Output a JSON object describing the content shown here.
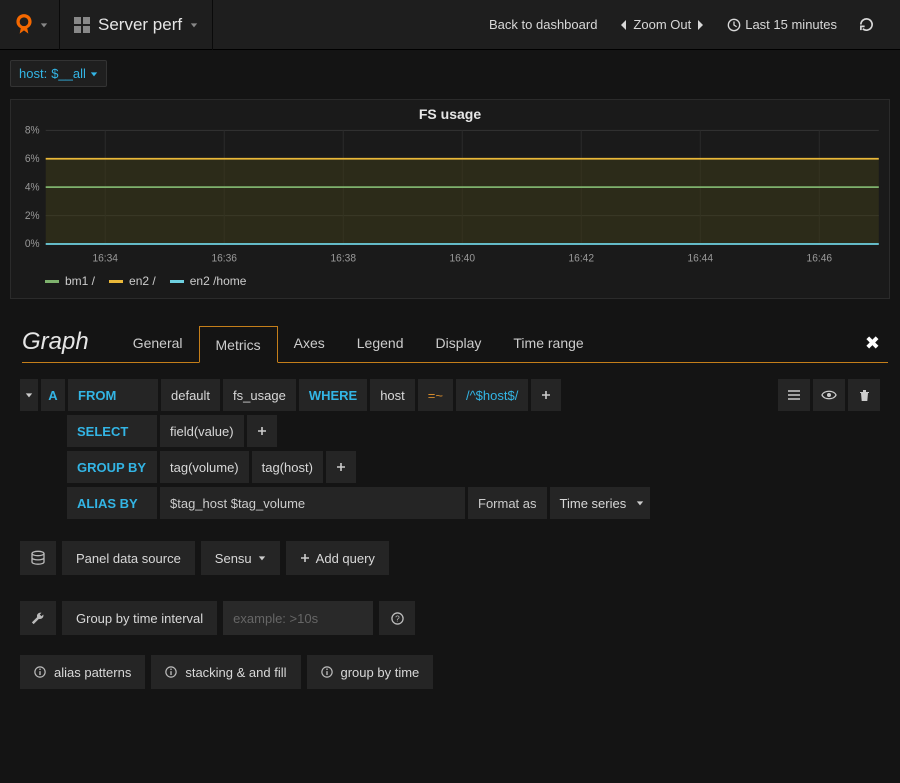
{
  "header": {
    "dash_title": "Server perf",
    "back": "Back to dashboard",
    "zoom": "Zoom Out",
    "time_range": "Last 15 minutes"
  },
  "variables": {
    "host_label": "host:",
    "host_value": "$__all"
  },
  "panel": {
    "title": "FS usage"
  },
  "chart_data": {
    "type": "line",
    "title": "FS usage",
    "ylabel": "",
    "ylim": [
      0,
      8
    ],
    "y_ticks": [
      "0%",
      "2%",
      "4%",
      "6%",
      "8%"
    ],
    "x_ticks": [
      "16:34",
      "16:36",
      "16:38",
      "16:40",
      "16:42",
      "16:44",
      "16:46"
    ],
    "series": [
      {
        "name": "bm1 /",
        "color": "#7EB26D",
        "values": [
          4,
          4,
          4,
          4,
          4,
          4,
          4,
          4,
          4,
          4,
          4,
          4,
          4,
          4,
          4
        ]
      },
      {
        "name": "en2 /",
        "color": "#EAB839",
        "values": [
          6,
          6,
          6,
          6,
          6,
          6,
          6,
          6,
          6,
          6,
          6,
          6,
          6,
          6,
          6
        ]
      },
      {
        "name": "en2 /home",
        "color": "#6ED0E0",
        "values": [
          0,
          0,
          0,
          0,
          0,
          0,
          0,
          0,
          0,
          0,
          0,
          0,
          0,
          0,
          0
        ]
      }
    ]
  },
  "editor": {
    "title": "Graph",
    "tabs": [
      "General",
      "Metrics",
      "Axes",
      "Legend",
      "Display",
      "Time range"
    ],
    "active_tab": "Metrics"
  },
  "query": {
    "letter": "A",
    "from_kw": "FROM",
    "policy": "default",
    "measurement": "fs_usage",
    "where_kw": "WHERE",
    "tag_key": "host",
    "operator": "=~",
    "tag_value": "/^$host$/",
    "select_kw": "SELECT",
    "select_field": "field(value)",
    "group_kw": "GROUP BY",
    "group_tag1": "tag(volume)",
    "group_tag2": "tag(host)",
    "alias_kw": "ALIAS BY",
    "alias_value": "$tag_host $tag_volume",
    "format_label": "Format as",
    "format_value": "Time series"
  },
  "datasource": {
    "label": "Panel data source",
    "value": "Sensu",
    "add_query": "Add query"
  },
  "interval": {
    "label": "Group by time interval",
    "placeholder": "example: >10s"
  },
  "help": {
    "alias": "alias patterns",
    "stacking": "stacking & and fill",
    "group": "group by time"
  }
}
